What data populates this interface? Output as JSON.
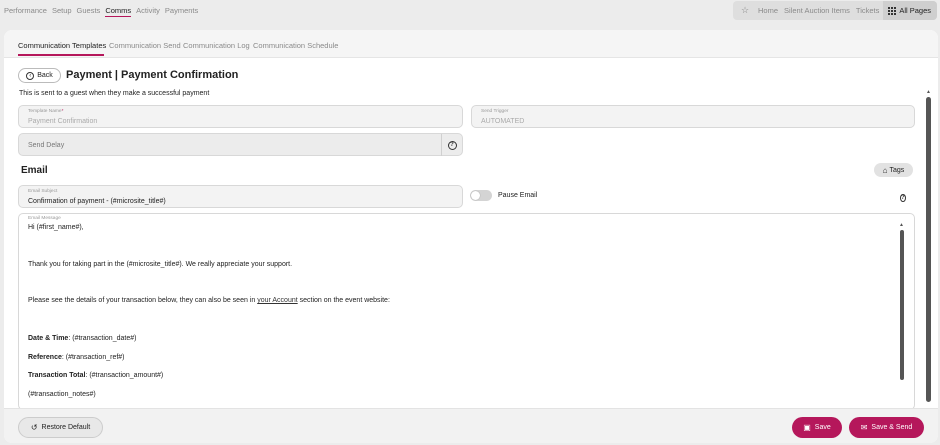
{
  "top_nav": {
    "items": [
      "Performance",
      "Setup",
      "Guests",
      "Comms",
      "Activity",
      "Payments"
    ],
    "active": "Comms"
  },
  "quick_links": {
    "star_icon": "star-icon",
    "items": [
      "Home",
      "Silent Auction Items",
      "Tickets"
    ],
    "all_pages_label": "All Pages"
  },
  "sub_tabs": {
    "items": [
      "Communication Templates",
      "Communication Send",
      "Communication Log",
      "Communication Schedule"
    ],
    "active": "Communication Templates"
  },
  "header": {
    "back_label": "Back",
    "title": "Payment | Payment Confirmation",
    "description": "This is sent to a guest when they make a successful payment"
  },
  "fields": {
    "template_name": {
      "label": "Template Name",
      "required_mark": "*",
      "value": "Payment Confirmation"
    },
    "send_trigger": {
      "label": "Send Trigger",
      "value": "AUTOMATED"
    },
    "send_delay": {
      "placeholder": "Send Delay"
    }
  },
  "email": {
    "section_title": "Email",
    "tags_label": "Tags",
    "subject_label": "Email Subject",
    "subject_value": "Confirmation of payment - (#microsite_title#)",
    "pause_label": "Pause Email",
    "pause_on": false,
    "message_label": "Email Message",
    "message": {
      "greeting": "Hi (#first_name#),",
      "thanks": "Thank you for taking part in the (#microsite_title#). We really appreciate your support.",
      "details_before": "Please see the details of your transaction below, they can also be seen in ",
      "details_link": "your Account",
      "details_after": " section on the event website:",
      "date_label": "Date & Time",
      "date_value": ": (#transaction_date#)",
      "ref_label": "Reference",
      "ref_value": ": (#transaction_ref#)",
      "total_label": "Transaction Total",
      "total_value": ": (#transaction_amount#)",
      "notes": "(#transaction_notes#)"
    }
  },
  "footer": {
    "restore_label": "Restore Default",
    "save_label": "Save",
    "save_send_label": "Save & Send"
  },
  "colors": {
    "accent": "#b5175b",
    "background": "#ececec",
    "card": "#ffffff"
  }
}
